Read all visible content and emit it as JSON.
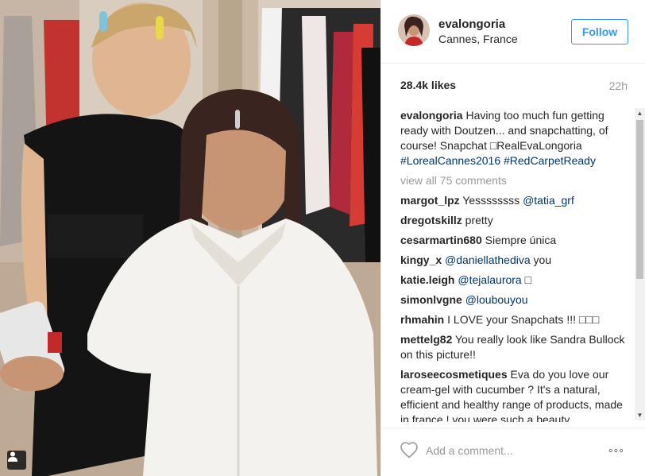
{
  "post": {
    "username": "evalongoria",
    "location": "Cannes, France",
    "follow_label": "Follow",
    "likes": "28.4k likes",
    "time": "22h",
    "caption": {
      "username": "evalongoria",
      "text": " Having too much fun getting ready with Doutzen... and snapchatting, of course! Snapchat □RealEvaLongoria ",
      "tags": [
        "#LorealCannes2016",
        "#RedCarpetReady"
      ]
    },
    "view_all": "view all 75 comments",
    "comments": [
      {
        "user": "margot_lpz",
        "text": " Yessssssss ",
        "mention": "@tatia_grf",
        "after": ""
      },
      {
        "user": "dregotskillz",
        "text": " pretty",
        "mention": "",
        "after": ""
      },
      {
        "user": "cesarmartin680",
        "text": " Siempre única",
        "mention": "",
        "after": ""
      },
      {
        "user": "kingy_x",
        "text": " ",
        "mention": "@daniellathediva",
        "after": " you"
      },
      {
        "user": "katie.leigh",
        "text": " ",
        "mention": "@tejalaurora",
        "after": " □"
      },
      {
        "user": "simonlvgne",
        "text": " ",
        "mention": "@loubouyou",
        "after": ""
      },
      {
        "user": "rhmahin",
        "text": " I LOVE your Snapchats !!! □□□",
        "mention": "",
        "after": ""
      },
      {
        "user": "mettelg82",
        "text": " You really look like Sandra Bullock on this picture!!",
        "mention": "",
        "after": ""
      },
      {
        "user": "laroseecosmetiques",
        "text": " Eva do you love our cream-gel with cucumber ? It's a natural, efficient and healthy range of products, made in france ! you were such a beauty",
        "mention": "",
        "after": ""
      }
    ],
    "add_comment_placeholder": "Add a comment...",
    "more_label": "◦◦◦"
  },
  "icons": {
    "heart": "heart-icon",
    "more": "more-options-icon",
    "tag": "user-tag-icon"
  },
  "colors": {
    "accent": "#3897f0",
    "hashtag": "#003569",
    "muted": "#999999"
  }
}
